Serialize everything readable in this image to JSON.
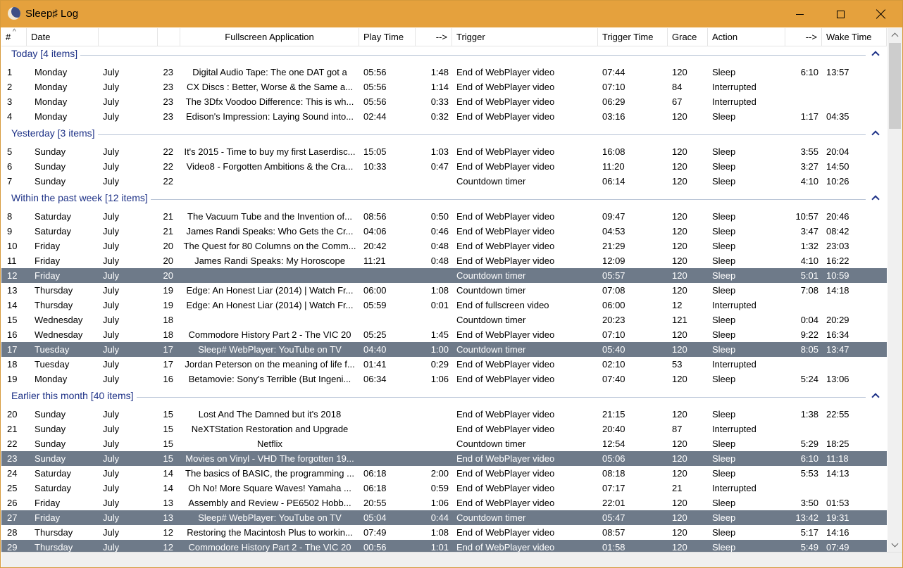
{
  "window": {
    "title": "Sleep♯ Log"
  },
  "columns": [
    {
      "label": "#"
    },
    {
      "label": "Date"
    },
    {
      "label": ""
    },
    {
      "label": ""
    },
    {
      "label": "Fullscreen Application"
    },
    {
      "label": "Play Time"
    },
    {
      "label": "-->"
    },
    {
      "label": "Trigger"
    },
    {
      "label": "Trigger Time"
    },
    {
      "label": "Grace"
    },
    {
      "label": "Action"
    },
    {
      "label": "-->"
    },
    {
      "label": "Wake Time"
    }
  ],
  "sort_indicator": "^",
  "groups": [
    {
      "label": "Today [4 items]",
      "rows": [
        {
          "num": "1",
          "day": "Monday",
          "month": "July",
          "date": "23",
          "app": "Digital Audio Tape: The one DAT got a",
          "play": "05:56",
          "dur1": "1:48",
          "trigger": "End of WebPlayer video",
          "ttime": "07:44",
          "grace": "120",
          "action": "Sleep",
          "dur2": "6:10",
          "wake": "13:57"
        },
        {
          "num": "2",
          "day": "Monday",
          "month": "July",
          "date": "23",
          "app": "CX Discs : Better, Worse & the Same a...",
          "play": "05:56",
          "dur1": "1:14",
          "trigger": "End of WebPlayer video",
          "ttime": "07:10",
          "grace": "84",
          "action": "Interrupted",
          "dur2": "",
          "wake": ""
        },
        {
          "num": "3",
          "day": "Monday",
          "month": "July",
          "date": "23",
          "app": "The 3Dfx Voodoo Difference: This is wh...",
          "play": "05:56",
          "dur1": "0:33",
          "trigger": "End of WebPlayer video",
          "ttime": "06:29",
          "grace": "67",
          "action": "Interrupted",
          "dur2": "",
          "wake": ""
        },
        {
          "num": "4",
          "day": "Monday",
          "month": "July",
          "date": "23",
          "app": "Edison's Impression: Laying Sound into...",
          "play": "02:44",
          "dur1": "0:32",
          "trigger": "End of WebPlayer video",
          "ttime": "03:16",
          "grace": "120",
          "action": "Sleep",
          "dur2": "1:17",
          "wake": "04:35"
        }
      ]
    },
    {
      "label": "Yesterday [3 items]",
      "rows": [
        {
          "num": "5",
          "day": "Sunday",
          "month": "July",
          "date": "22",
          "app": "It's 2015 - Time to buy my first Laserdisc...",
          "play": "15:05",
          "dur1": "1:03",
          "trigger": "End of WebPlayer video",
          "ttime": "16:08",
          "grace": "120",
          "action": "Sleep",
          "dur2": "3:55",
          "wake": "20:04"
        },
        {
          "num": "6",
          "day": "Sunday",
          "month": "July",
          "date": "22",
          "app": "Video8 - Forgotten Ambitions & the Cra...",
          "play": "10:33",
          "dur1": "0:47",
          "trigger": "End of WebPlayer video",
          "ttime": "11:20",
          "grace": "120",
          "action": "Sleep",
          "dur2": "3:27",
          "wake": "14:50"
        },
        {
          "num": "7",
          "day": "Sunday",
          "month": "July",
          "date": "22",
          "app": "",
          "play": "",
          "dur1": "",
          "trigger": "Countdown timer",
          "ttime": "06:14",
          "grace": "120",
          "action": "Sleep",
          "dur2": "4:10",
          "wake": "10:26"
        }
      ]
    },
    {
      "label": "Within the past week [12 items]",
      "rows": [
        {
          "num": "8",
          "day": "Saturday",
          "month": "July",
          "date": "21",
          "app": "The Vacuum Tube and the Invention of...",
          "play": "08:56",
          "dur1": "0:50",
          "trigger": "End of WebPlayer video",
          "ttime": "09:47",
          "grace": "120",
          "action": "Sleep",
          "dur2": "10:57",
          "wake": "20:46"
        },
        {
          "num": "9",
          "day": "Saturday",
          "month": "July",
          "date": "21",
          "app": "James Randi Speaks: Who Gets the Cr...",
          "play": "04:06",
          "dur1": "0:46",
          "trigger": "End of WebPlayer video",
          "ttime": "04:53",
          "grace": "120",
          "action": "Sleep",
          "dur2": "3:47",
          "wake": "08:42"
        },
        {
          "num": "10",
          "day": "Friday",
          "month": "July",
          "date": "20",
          "app": "The Quest for 80 Columns on the Comm...",
          "play": "20:42",
          "dur1": "0:48",
          "trigger": "End of WebPlayer video",
          "ttime": "21:29",
          "grace": "120",
          "action": "Sleep",
          "dur2": "1:32",
          "wake": "23:03"
        },
        {
          "num": "11",
          "day": "Friday",
          "month": "July",
          "date": "20",
          "app": "James Randi Speaks: My Horoscope",
          "play": "11:21",
          "dur1": "0:48",
          "trigger": "End of WebPlayer video",
          "ttime": "12:09",
          "grace": "120",
          "action": "Sleep",
          "dur2": "4:10",
          "wake": "16:22"
        },
        {
          "num": "12",
          "day": "Friday",
          "month": "July",
          "date": "20",
          "app": "",
          "play": "",
          "dur1": "",
          "trigger": "Countdown timer",
          "ttime": "05:57",
          "grace": "120",
          "action": "Sleep",
          "dur2": "5:01",
          "wake": "10:59",
          "selected": true
        },
        {
          "num": "13",
          "day": "Thursday",
          "month": "July",
          "date": "19",
          "app": "Edge: An Honest Liar (2014) | Watch Fr...",
          "play": "06:00",
          "dur1": "1:08",
          "trigger": "Countdown timer",
          "ttime": "07:08",
          "grace": "120",
          "action": "Sleep",
          "dur2": "7:08",
          "wake": "14:18"
        },
        {
          "num": "14",
          "day": "Thursday",
          "month": "July",
          "date": "19",
          "app": "Edge: An Honest Liar (2014) | Watch Fr...",
          "play": "05:59",
          "dur1": "0:01",
          "trigger": "End of fullscreen video",
          "ttime": "06:00",
          "grace": "12",
          "action": "Interrupted",
          "dur2": "",
          "wake": ""
        },
        {
          "num": "15",
          "day": "Wednesday",
          "month": "July",
          "date": "18",
          "app": "",
          "play": "",
          "dur1": "",
          "trigger": "Countdown timer",
          "ttime": "20:23",
          "grace": "121",
          "action": "Sleep",
          "dur2": "0:04",
          "wake": "20:29"
        },
        {
          "num": "16",
          "day": "Wednesday",
          "month": "July",
          "date": "18",
          "app": "Commodore History Part 2 - The VIC 20",
          "play": "05:25",
          "dur1": "1:45",
          "trigger": "End of WebPlayer video",
          "ttime": "07:10",
          "grace": "120",
          "action": "Sleep",
          "dur2": "9:22",
          "wake": "16:34"
        },
        {
          "num": "17",
          "day": "Tuesday",
          "month": "July",
          "date": "17",
          "app": "Sleep# WebPlayer: YouTube on TV",
          "play": "04:40",
          "dur1": "1:00",
          "trigger": "Countdown timer",
          "ttime": "05:40",
          "grace": "120",
          "action": "Sleep",
          "dur2": "8:05",
          "wake": "13:47",
          "selected": true
        },
        {
          "num": "18",
          "day": "Tuesday",
          "month": "July",
          "date": "17",
          "app": "Jordan Peterson on the meaning of life f...",
          "play": "01:41",
          "dur1": "0:29",
          "trigger": "End of WebPlayer video",
          "ttime": "02:10",
          "grace": "53",
          "action": "Interrupted",
          "dur2": "",
          "wake": ""
        },
        {
          "num": "19",
          "day": "Monday",
          "month": "July",
          "date": "16",
          "app": "Betamovie: Sony's Terrible (But Ingeni...",
          "play": "06:34",
          "dur1": "1:06",
          "trigger": "End of WebPlayer video",
          "ttime": "07:40",
          "grace": "120",
          "action": "Sleep",
          "dur2": "5:24",
          "wake": "13:06"
        }
      ]
    },
    {
      "label": "Earlier this month [40 items]",
      "rows": [
        {
          "num": "20",
          "day": "Sunday",
          "month": "July",
          "date": "15",
          "app": "Lost And The Damned but it's 2018",
          "play": "",
          "dur1": "",
          "trigger": "End of WebPlayer video",
          "ttime": "21:15",
          "grace": "120",
          "action": "Sleep",
          "dur2": "1:38",
          "wake": "22:55"
        },
        {
          "num": "21",
          "day": "Sunday",
          "month": "July",
          "date": "15",
          "app": "NeXTStation Restoration and Upgrade",
          "play": "",
          "dur1": "",
          "trigger": "End of WebPlayer video",
          "ttime": "20:40",
          "grace": "87",
          "action": "Interrupted",
          "dur2": "",
          "wake": ""
        },
        {
          "num": "22",
          "day": "Sunday",
          "month": "July",
          "date": "15",
          "app": "Netflix",
          "play": "",
          "dur1": "",
          "trigger": "Countdown timer",
          "ttime": "12:54",
          "grace": "120",
          "action": "Sleep",
          "dur2": "5:29",
          "wake": "18:25"
        },
        {
          "num": "23",
          "day": "Sunday",
          "month": "July",
          "date": "15",
          "app": "Movies on Vinyl - VHD The forgotten 19...",
          "play": "",
          "dur1": "",
          "trigger": "End of WebPlayer video",
          "ttime": "05:06",
          "grace": "120",
          "action": "Sleep",
          "dur2": "6:10",
          "wake": "11:18",
          "selected": true
        },
        {
          "num": "24",
          "day": "Saturday",
          "month": "July",
          "date": "14",
          "app": "The basics of BASIC, the programming ...",
          "play": "06:18",
          "dur1": "2:00",
          "trigger": "End of WebPlayer video",
          "ttime": "08:18",
          "grace": "120",
          "action": "Sleep",
          "dur2": "5:53",
          "wake": "14:13"
        },
        {
          "num": "25",
          "day": "Saturday",
          "month": "July",
          "date": "14",
          "app": "Oh No! More Square Waves! Yamaha ...",
          "play": "06:18",
          "dur1": "0:59",
          "trigger": "End of WebPlayer video",
          "ttime": "07:17",
          "grace": "21",
          "action": "Interrupted",
          "dur2": "",
          "wake": ""
        },
        {
          "num": "26",
          "day": "Friday",
          "month": "July",
          "date": "13",
          "app": "Assembly and Review - PE6502 Hobb...",
          "play": "20:55",
          "dur1": "1:06",
          "trigger": "End of WebPlayer video",
          "ttime": "22:01",
          "grace": "120",
          "action": "Sleep",
          "dur2": "3:50",
          "wake": "01:53"
        },
        {
          "num": "27",
          "day": "Friday",
          "month": "July",
          "date": "13",
          "app": "Sleep# WebPlayer: YouTube on TV",
          "play": "05:04",
          "dur1": "0:44",
          "trigger": "Countdown timer",
          "ttime": "05:47",
          "grace": "120",
          "action": "Sleep",
          "dur2": "13:42",
          "wake": "19:31",
          "selected": true
        },
        {
          "num": "28",
          "day": "Thursday",
          "month": "July",
          "date": "12",
          "app": "Restoring the Macintosh Plus to workin...",
          "play": "07:49",
          "dur1": "1:08",
          "trigger": "End of WebPlayer video",
          "ttime": "08:57",
          "grace": "120",
          "action": "Sleep",
          "dur2": "5:17",
          "wake": "14:16"
        },
        {
          "num": "29",
          "day": "Thursday",
          "month": "July",
          "date": "12",
          "app": "Commodore History Part 2 - The VIC 20",
          "play": "00:56",
          "dur1": "1:01",
          "trigger": "End of WebPlayer video",
          "ttime": "01:58",
          "grace": "120",
          "action": "Sleep",
          "dur2": "5:49",
          "wake": "07:49",
          "selected": true
        }
      ]
    }
  ]
}
